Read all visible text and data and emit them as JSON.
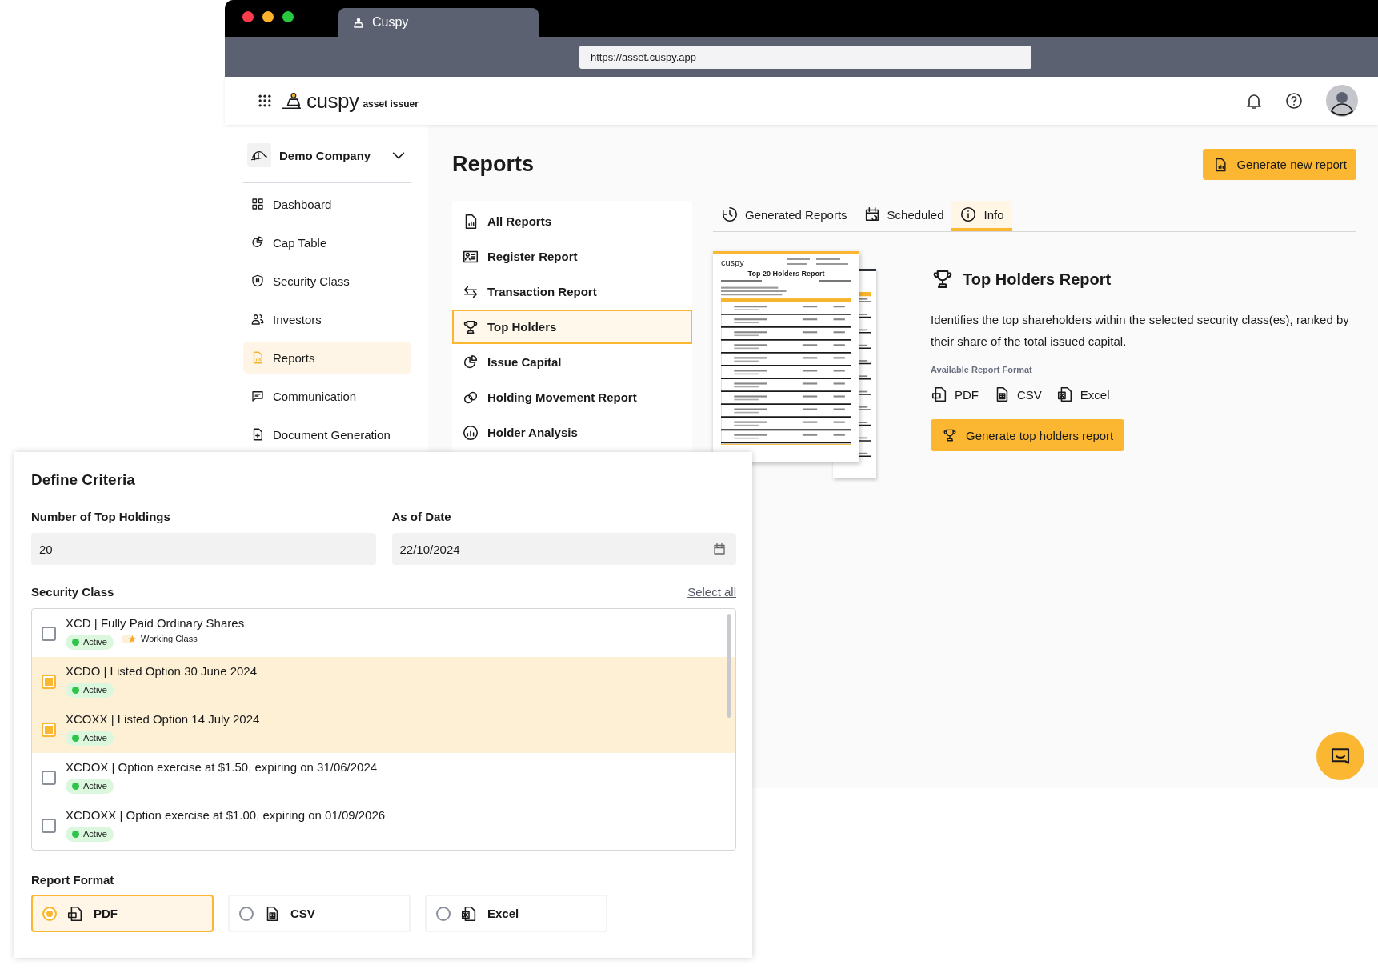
{
  "browser": {
    "tab_title": "Cuspy",
    "url": "https://asset.cuspy.app"
  },
  "header": {
    "logo_text": "cuspy",
    "logo_subtitle": "asset issuer"
  },
  "sidebar": {
    "company": "Demo Company",
    "items": [
      {
        "label": "Dashboard",
        "selected": false
      },
      {
        "label": "Cap Table",
        "selected": false
      },
      {
        "label": "Security Class",
        "selected": false
      },
      {
        "label": "Investors",
        "selected": false
      },
      {
        "label": "Reports",
        "selected": true
      },
      {
        "label": "Communication",
        "selected": false
      },
      {
        "label": "Document Generation",
        "selected": false
      }
    ]
  },
  "page_title": "Reports",
  "primary_button": "Generate new report",
  "report_menu": [
    {
      "label": "All Reports",
      "selected": false
    },
    {
      "label": "Register Report",
      "selected": false
    },
    {
      "label": "Transaction Report",
      "selected": false
    },
    {
      "label": "Top Holders",
      "selected": true
    },
    {
      "label": "Issue Capital",
      "selected": false
    },
    {
      "label": "Holding Movement Report",
      "selected": false
    },
    {
      "label": "Holder Analysis",
      "selected": false
    }
  ],
  "tabs": [
    {
      "label": "Generated Reports",
      "selected": false
    },
    {
      "label": "Scheduled",
      "selected": false
    },
    {
      "label": "Info",
      "selected": true
    }
  ],
  "preview": {
    "logo": "cuspy",
    "title": "Top 20 Holders Report"
  },
  "info": {
    "title": "Top Holders Report",
    "description": "Identifies the top shareholders within the selected security class(es), ranked by their share of the total issued capital.",
    "formats_label": "Available Report Format",
    "formats": [
      {
        "label": "PDF",
        "kind": "pdf"
      },
      {
        "label": "CSV",
        "kind": "csv"
      },
      {
        "label": "Excel",
        "kind": "excel"
      }
    ],
    "button": "Generate top holders report"
  },
  "criteria": {
    "title": "Define Criteria",
    "fields": [
      {
        "label": "Number of Top Holdings",
        "value": "20",
        "kind": "text"
      },
      {
        "label": "As of Date",
        "value": "22/10/2024",
        "kind": "date"
      }
    ],
    "security_class_label": "Security Class",
    "select_all": "Select all",
    "classes": [
      {
        "name": "XCD | Fully Paid Ordinary Shares",
        "checked": false,
        "tags": [
          {
            "label": "Active",
            "kind": "status"
          },
          {
            "label": "Working Class",
            "kind": "star"
          }
        ]
      },
      {
        "name": "XCDO | Listed Option 30 June 2024",
        "checked": true,
        "tags": [
          {
            "label": "Active",
            "kind": "status"
          }
        ]
      },
      {
        "name": "XCOXX | Listed Option 14 July 2024",
        "checked": true,
        "tags": [
          {
            "label": "Active",
            "kind": "status"
          }
        ]
      },
      {
        "name": "XCDOX | Option exercise at $1.50, expiring on 31/06/2024",
        "checked": false,
        "tags": [
          {
            "label": "Active",
            "kind": "status"
          }
        ]
      },
      {
        "name": "XCDOXX | Option exercise at $1.00, expiring on 01/09/2026",
        "checked": false,
        "tags": [
          {
            "label": "Active",
            "kind": "status"
          }
        ]
      }
    ],
    "format_label": "Report Format",
    "format_options": [
      {
        "label": "PDF",
        "kind": "pdf",
        "selected": true
      },
      {
        "label": "CSV",
        "kind": "csv",
        "selected": false
      },
      {
        "label": "Excel",
        "kind": "excel",
        "selected": false
      }
    ]
  }
}
